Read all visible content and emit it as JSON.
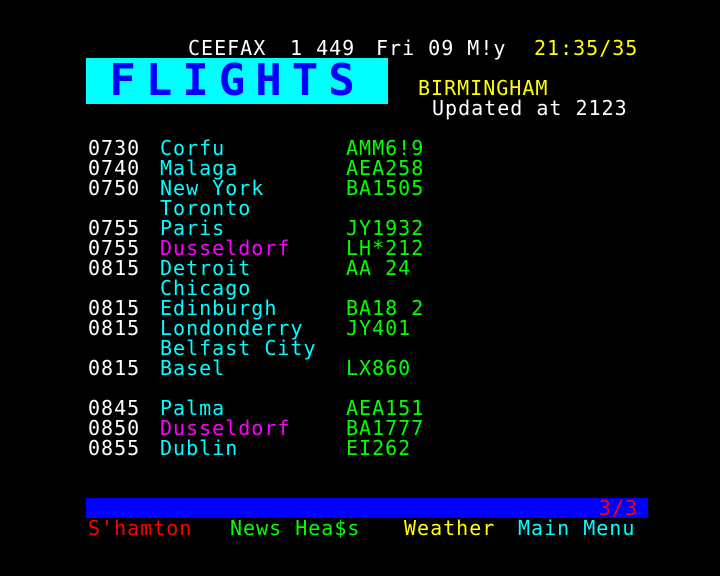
{
  "header": {
    "service": "CEEFAX",
    "page_number": "1 449",
    "date": "Fri 09 M!y",
    "time": "21:35/35"
  },
  "logo": {
    "title": "FLIGHTS"
  },
  "subheader": {
    "airport": "BIRMINGHAM",
    "updated": "Updated at 2123"
  },
  "colors": {
    "background": "#000000",
    "header_text": "#ffffff",
    "time": "#ffff00",
    "destination": "#00ffff",
    "destination_alt": "#ff00ff",
    "flight_no": "#00ff00",
    "logo_bg": "#00ffff",
    "logo_fg": "#0000ff",
    "bar": "#0000ff",
    "counter": "#ff0000"
  },
  "flights": [
    {
      "time": "0730",
      "destination": "Corfu",
      "flight": "AMM6!9",
      "highlight": false
    },
    {
      "time": "0740",
      "destination": "Malaga",
      "flight": "AEA258",
      "highlight": false
    },
    {
      "time": "0750",
      "destination": "New York",
      "flight": "BA1505",
      "highlight": false
    },
    {
      "time": "",
      "destination": "Toronto",
      "flight": "",
      "highlight": false
    },
    {
      "time": "0755",
      "destination": "Paris",
      "flight": "JY1932",
      "highlight": false
    },
    {
      "time": "0755",
      "destination": "Dusseldorf",
      "flight": "LH*212",
      "highlight": true
    },
    {
      "time": "0815",
      "destination": "Detroit",
      "flight": "AA 24",
      "highlight": false
    },
    {
      "time": "",
      "destination": "Chicago",
      "flight": "",
      "highlight": false
    },
    {
      "time": "0815",
      "destination": "Edinburgh",
      "flight": "BA18 2",
      "highlight": false
    },
    {
      "time": "0815",
      "destination": "Londonderry",
      "flight": "JY401",
      "highlight": false
    },
    {
      "time": "",
      "destination": "Belfast City",
      "flight": "",
      "highlight": false
    },
    {
      "time": "0815",
      "destination": "Basel",
      "flight": "LX860",
      "highlight": false
    },
    {
      "time": "",
      "destination": "",
      "flight": "",
      "highlight": false
    },
    {
      "time": "0845",
      "destination": "Palma",
      "flight": "AEA151",
      "highlight": false
    },
    {
      "time": "0850",
      "destination": "Dusseldorf",
      "flight": "BA1777",
      "highlight": true
    },
    {
      "time": "0855",
      "destination": "Dublin",
      "flight": "EI262",
      "highlight": false
    }
  ],
  "footer": {
    "page_counter": "3/3",
    "links": {
      "red": "S'hamton",
      "green": "News Hea$s",
      "yellow": "Weather",
      "cyan": "Main Menu"
    }
  }
}
